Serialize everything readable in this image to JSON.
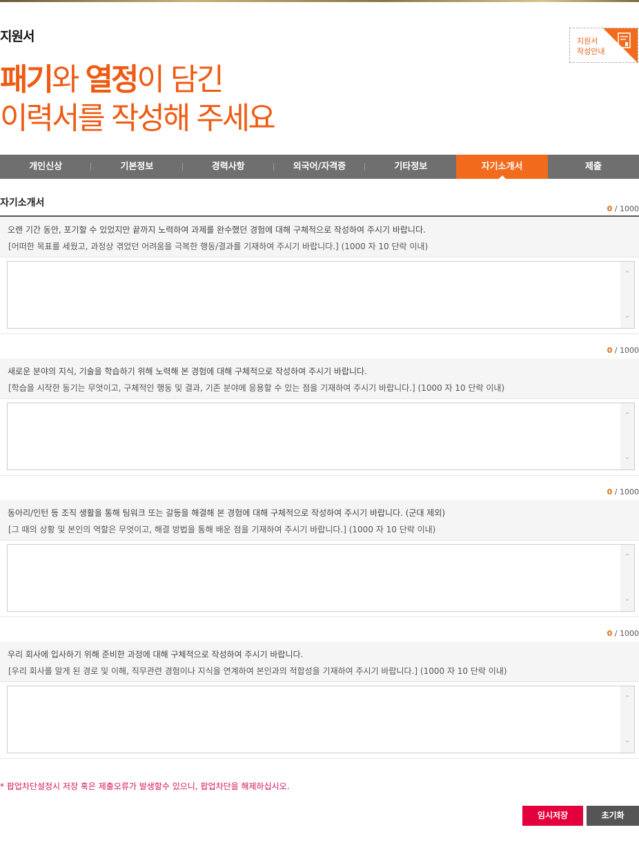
{
  "header": {
    "page_title": "지원서",
    "slogan_line1_part1": "패기",
    "slogan_line1_part2": "와 ",
    "slogan_line1_part3": "열정",
    "slogan_line1_part4": "이 담긴",
    "slogan_line2": "이력서를 작성해 주세요",
    "guide_line1": "지원서",
    "guide_line2": "작성안내",
    "brand_color": "#f26a1b"
  },
  "tabs": [
    {
      "label": "개인신상",
      "active": false
    },
    {
      "label": "기본정보",
      "active": false
    },
    {
      "label": "경력사항",
      "active": false
    },
    {
      "label": "외국어/자격증",
      "active": false
    },
    {
      "label": "기타정보",
      "active": false
    },
    {
      "label": "자기소개서",
      "active": true
    },
    {
      "label": "제출",
      "active": false
    }
  ],
  "section": {
    "title": "자기소개서"
  },
  "questions": [
    {
      "count": "0",
      "max": "/ 1000",
      "main": "오랜 기간 동안, 포기할 수 있었지만 끝까지 노력하여 과제를 완수했던 경험에 대해 구체적으로 작성하여 주시기 바랍니다.",
      "sub": "[어떠한 목표를 세웠고, 과정상 겪었던 어려움을 극복한 행동/결과를 기재하여 주시기 바랍니다.] (1000 자 10 단락 이내)",
      "value": ""
    },
    {
      "count": "0",
      "max": "/ 1000",
      "main": "새로운 분야의 지식, 기술을 학습하기 위해 노력해 본 경험에 대해 구체적으로 작성하여 주시기 바랍니다.",
      "sub": "[학습을 시작한 동기는 무엇이고, 구체적인 행동 및 결과, 기존 분야에 응용할 수 있는 점을 기재하여 주시기 바랍니다.] (1000 자 10 단락 이내)",
      "value": ""
    },
    {
      "count": "0",
      "max": "/ 1000",
      "main": "동아리/인턴 등 조직 생활을 통해 팀워크 또는 갈등을 해결해 본 경험에 대해 구체적으로 작성하여 주시기 바랍니다. (군대 제외)",
      "sub": "[그 때의 상황 및 본인의 역할은 무엇이고, 해결 방법을 통해 배운 점을 기재하여 주시기 바랍니다.] (1000 자 10 단락 이내)",
      "value": ""
    },
    {
      "count": "0",
      "max": "/ 1000",
      "main": "우리 회사에 입사하기 위해 준비한 과정에 대해 구체적으로 작성하여 주시기 바랍니다.",
      "sub": "[우리 회사를 알게 된 경로 및 이해, 직무관련 경험이나 지식을 연계하여 본인과의 적합성을 기재하여 주시기 바랍니다.] (1000 자 10 단락 이내)",
      "value": ""
    }
  ],
  "notice": "* 팝업차단설정시 저장 혹은 제출오류가 발생할수 있으니, 팝업차단을 해제하십시오.",
  "buttons": {
    "save": "임시저장",
    "reset": "초기화"
  },
  "icons": {
    "guide": "book-icon",
    "scroll_up": "chevron-up-icon",
    "scroll_down": "chevron-down-icon"
  }
}
